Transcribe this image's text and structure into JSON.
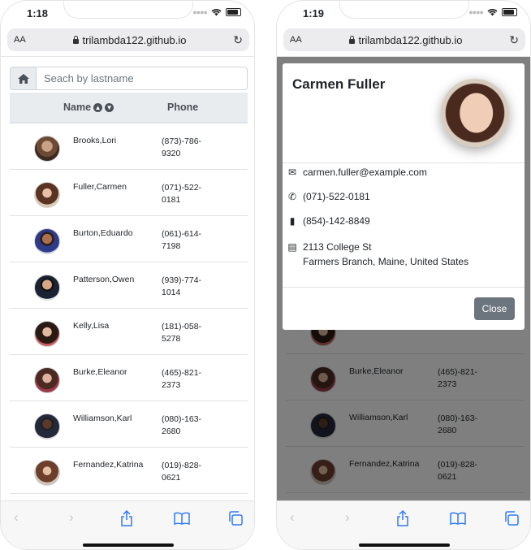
{
  "left": {
    "status_time": "1:18",
    "browser": {
      "text_size_label": "AA",
      "url": "trilambda122.github.io"
    },
    "search": {
      "placeholder": "Seach by lastname"
    },
    "table": {
      "headers": {
        "name": "Name",
        "phone": "Phone"
      },
      "rows": [
        {
          "name": "Brooks,Lori",
          "phone": "(873)-786-9320"
        },
        {
          "name": "Fuller,Carmen",
          "phone": "(071)-522-0181"
        },
        {
          "name": "Burton,Eduardo",
          "phone": "(061)-614-7198"
        },
        {
          "name": "Patterson,Owen",
          "phone": "(939)-774-1014"
        },
        {
          "name": "Kelly,Lisa",
          "phone": "(181)-058-5278"
        },
        {
          "name": "Burke,Eleanor",
          "phone": "(465)-821-2373"
        },
        {
          "name": "Williamson,Karl",
          "phone": "(080)-163-2680"
        },
        {
          "name": "Fernandez,Katrina",
          "phone": "(019)-828-0621"
        }
      ]
    }
  },
  "right": {
    "status_time": "1:19",
    "browser": {
      "text_size_label": "AA",
      "url": "trilambda122.github.io"
    },
    "table": {
      "rows": [
        {
          "name": "Burke,Eleanor",
          "phone": "(465)-821-2373"
        },
        {
          "name": "Williamson,Karl",
          "phone": "(080)-163-2680"
        },
        {
          "name": "Fernandez,Katrina",
          "phone": "(019)-828-0621"
        }
      ]
    },
    "modal": {
      "title": "Carmen Fuller",
      "email": "carmen.fuller@example.com",
      "phone": "(071)-522-0181",
      "cell": "(854)-142-8849",
      "address_line1": "2113 College St",
      "address_line2": "Farmers Branch, Maine, United States",
      "close_label": "Close"
    }
  },
  "icons": {
    "home": "home-icon",
    "sort": "sort-up-down-icon",
    "lock": "lock-icon",
    "reload": "reload-icon",
    "email": "envelope-icon",
    "phone": "phone-icon",
    "cell": "mobile-icon",
    "address": "id-card-icon",
    "back": "back-arrow-icon",
    "forward": "forward-arrow-icon",
    "share": "share-icon",
    "bookmarks": "bookmarks-icon",
    "tabs": "tabs-icon"
  },
  "colors": {
    "accent": "#2f7af7",
    "close_button": "#6c757d",
    "header_bg": "#e9ecef"
  }
}
